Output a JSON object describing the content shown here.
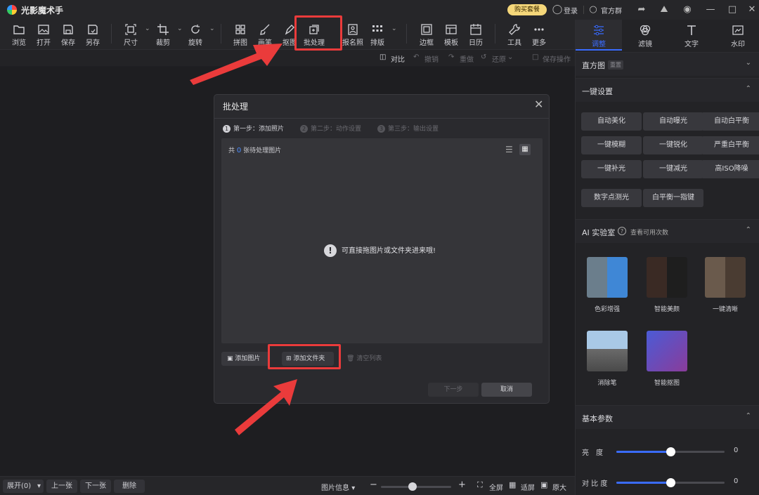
{
  "app": {
    "title": "光影魔术手",
    "buy_label": "购买套餐",
    "login_label": "登录",
    "group_label": "官方群"
  },
  "toolbar": {
    "items": [
      {
        "label": "浏览",
        "icon": "folder-icon"
      },
      {
        "label": "打开",
        "icon": "image-open-icon"
      },
      {
        "label": "保存",
        "icon": "save-icon"
      },
      {
        "label": "另存",
        "icon": "save-as-icon"
      },
      {
        "label": "尺寸",
        "icon": "resize-icon"
      },
      {
        "label": "裁剪",
        "icon": "crop-icon"
      },
      {
        "label": "旋转",
        "icon": "rotate-icon"
      },
      {
        "label": "拼图",
        "icon": "grid-icon"
      },
      {
        "label": "画笔",
        "icon": "brush-icon"
      },
      {
        "label": "抠图",
        "icon": "cutout-icon"
      },
      {
        "label": "批处理",
        "icon": "batch-icon"
      },
      {
        "label": "报名照",
        "icon": "id-photo-icon"
      },
      {
        "label": "排版",
        "icon": "layout-icon"
      },
      {
        "label": "边框",
        "icon": "frame-icon"
      },
      {
        "label": "模板",
        "icon": "template-icon"
      },
      {
        "label": "日历",
        "icon": "calendar-icon"
      },
      {
        "label": "工具",
        "icon": "wrench-icon"
      },
      {
        "label": "更多",
        "icon": "more-icon"
      }
    ],
    "sub": {
      "compare": "对比",
      "undo": "撤销",
      "redo": "重做",
      "restore": "还原",
      "save_op": "保存操作"
    }
  },
  "right_panel": {
    "tabs": [
      {
        "label": "调整"
      },
      {
        "label": "滤镜"
      },
      {
        "label": "文字"
      },
      {
        "label": "水印"
      }
    ],
    "histogram": {
      "title": "直方图",
      "badge": "重置"
    },
    "one_click": {
      "title": "一键设置",
      "buttons": [
        "自动美化",
        "自动曝光",
        "自动白平衡",
        "一键模糊",
        "一键锐化",
        "严重白平衡",
        "一键补光",
        "一键减光",
        "高ISO降噪",
        "数字点测光",
        "白平衡一指键"
      ]
    },
    "ai_lab": {
      "title": "AI 实验室",
      "link": "查看可用次数",
      "cards": [
        "色彩增强",
        "智能美颜",
        "一键清晰",
        "消除笔",
        "智能抠图"
      ]
    },
    "basic": {
      "title": "基本参数",
      "params": [
        {
          "name": "亮　度",
          "value": "0",
          "level": 0.5
        },
        {
          "name": "对 比 度",
          "value": "0",
          "level": 0.5
        }
      ]
    }
  },
  "bottom": {
    "expand": "展开(0)",
    "prev": "上一张",
    "next": "下一张",
    "delete": "删除",
    "info": "图片信息",
    "fullscreen": "全屏",
    "fit": "适屏",
    "original": "原大",
    "zoom_level": 0.45
  },
  "dialog": {
    "title": "批处理",
    "steps": [
      {
        "num": "1",
        "label": "第一步：添加照片"
      },
      {
        "num": "2",
        "label": "第二步：动作设置"
      },
      {
        "num": "3",
        "label": "第三步：输出设置"
      }
    ],
    "count_prefix": "共",
    "count": "0",
    "count_suffix": "张待处理图片",
    "drop_message": "可直接拖图片或文件夹进来哦!",
    "add_photo": "添加图片",
    "add_folder": "添加文件夹",
    "clear_list": "清空列表",
    "next": "下一步",
    "cancel": "取消"
  }
}
